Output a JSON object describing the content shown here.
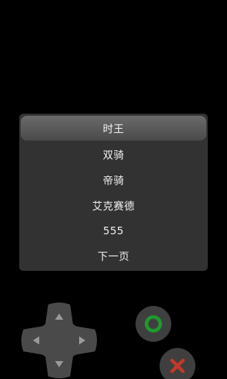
{
  "menu": {
    "items": [
      {
        "label": "时王",
        "selected": true
      },
      {
        "label": "双骑",
        "selected": false
      },
      {
        "label": "帝骑",
        "selected": false
      },
      {
        "label": "艾克赛德",
        "selected": false
      },
      {
        "label": "555",
        "selected": false
      },
      {
        "label": "下一页",
        "selected": false
      }
    ]
  },
  "controls": {
    "dpad": {
      "icon": "dpad-icon",
      "color": "#4a4a4a",
      "arrow_color": "#9a9a9a"
    },
    "confirm": {
      "icon": "circle-icon",
      "color": "#1f9a2e"
    },
    "cancel": {
      "icon": "cross-icon",
      "color": "#c0392b"
    }
  },
  "colors": {
    "background": "#000000",
    "panel": "#323232",
    "selected_item": "#5a5a5a",
    "text": "#f2f2f2"
  }
}
